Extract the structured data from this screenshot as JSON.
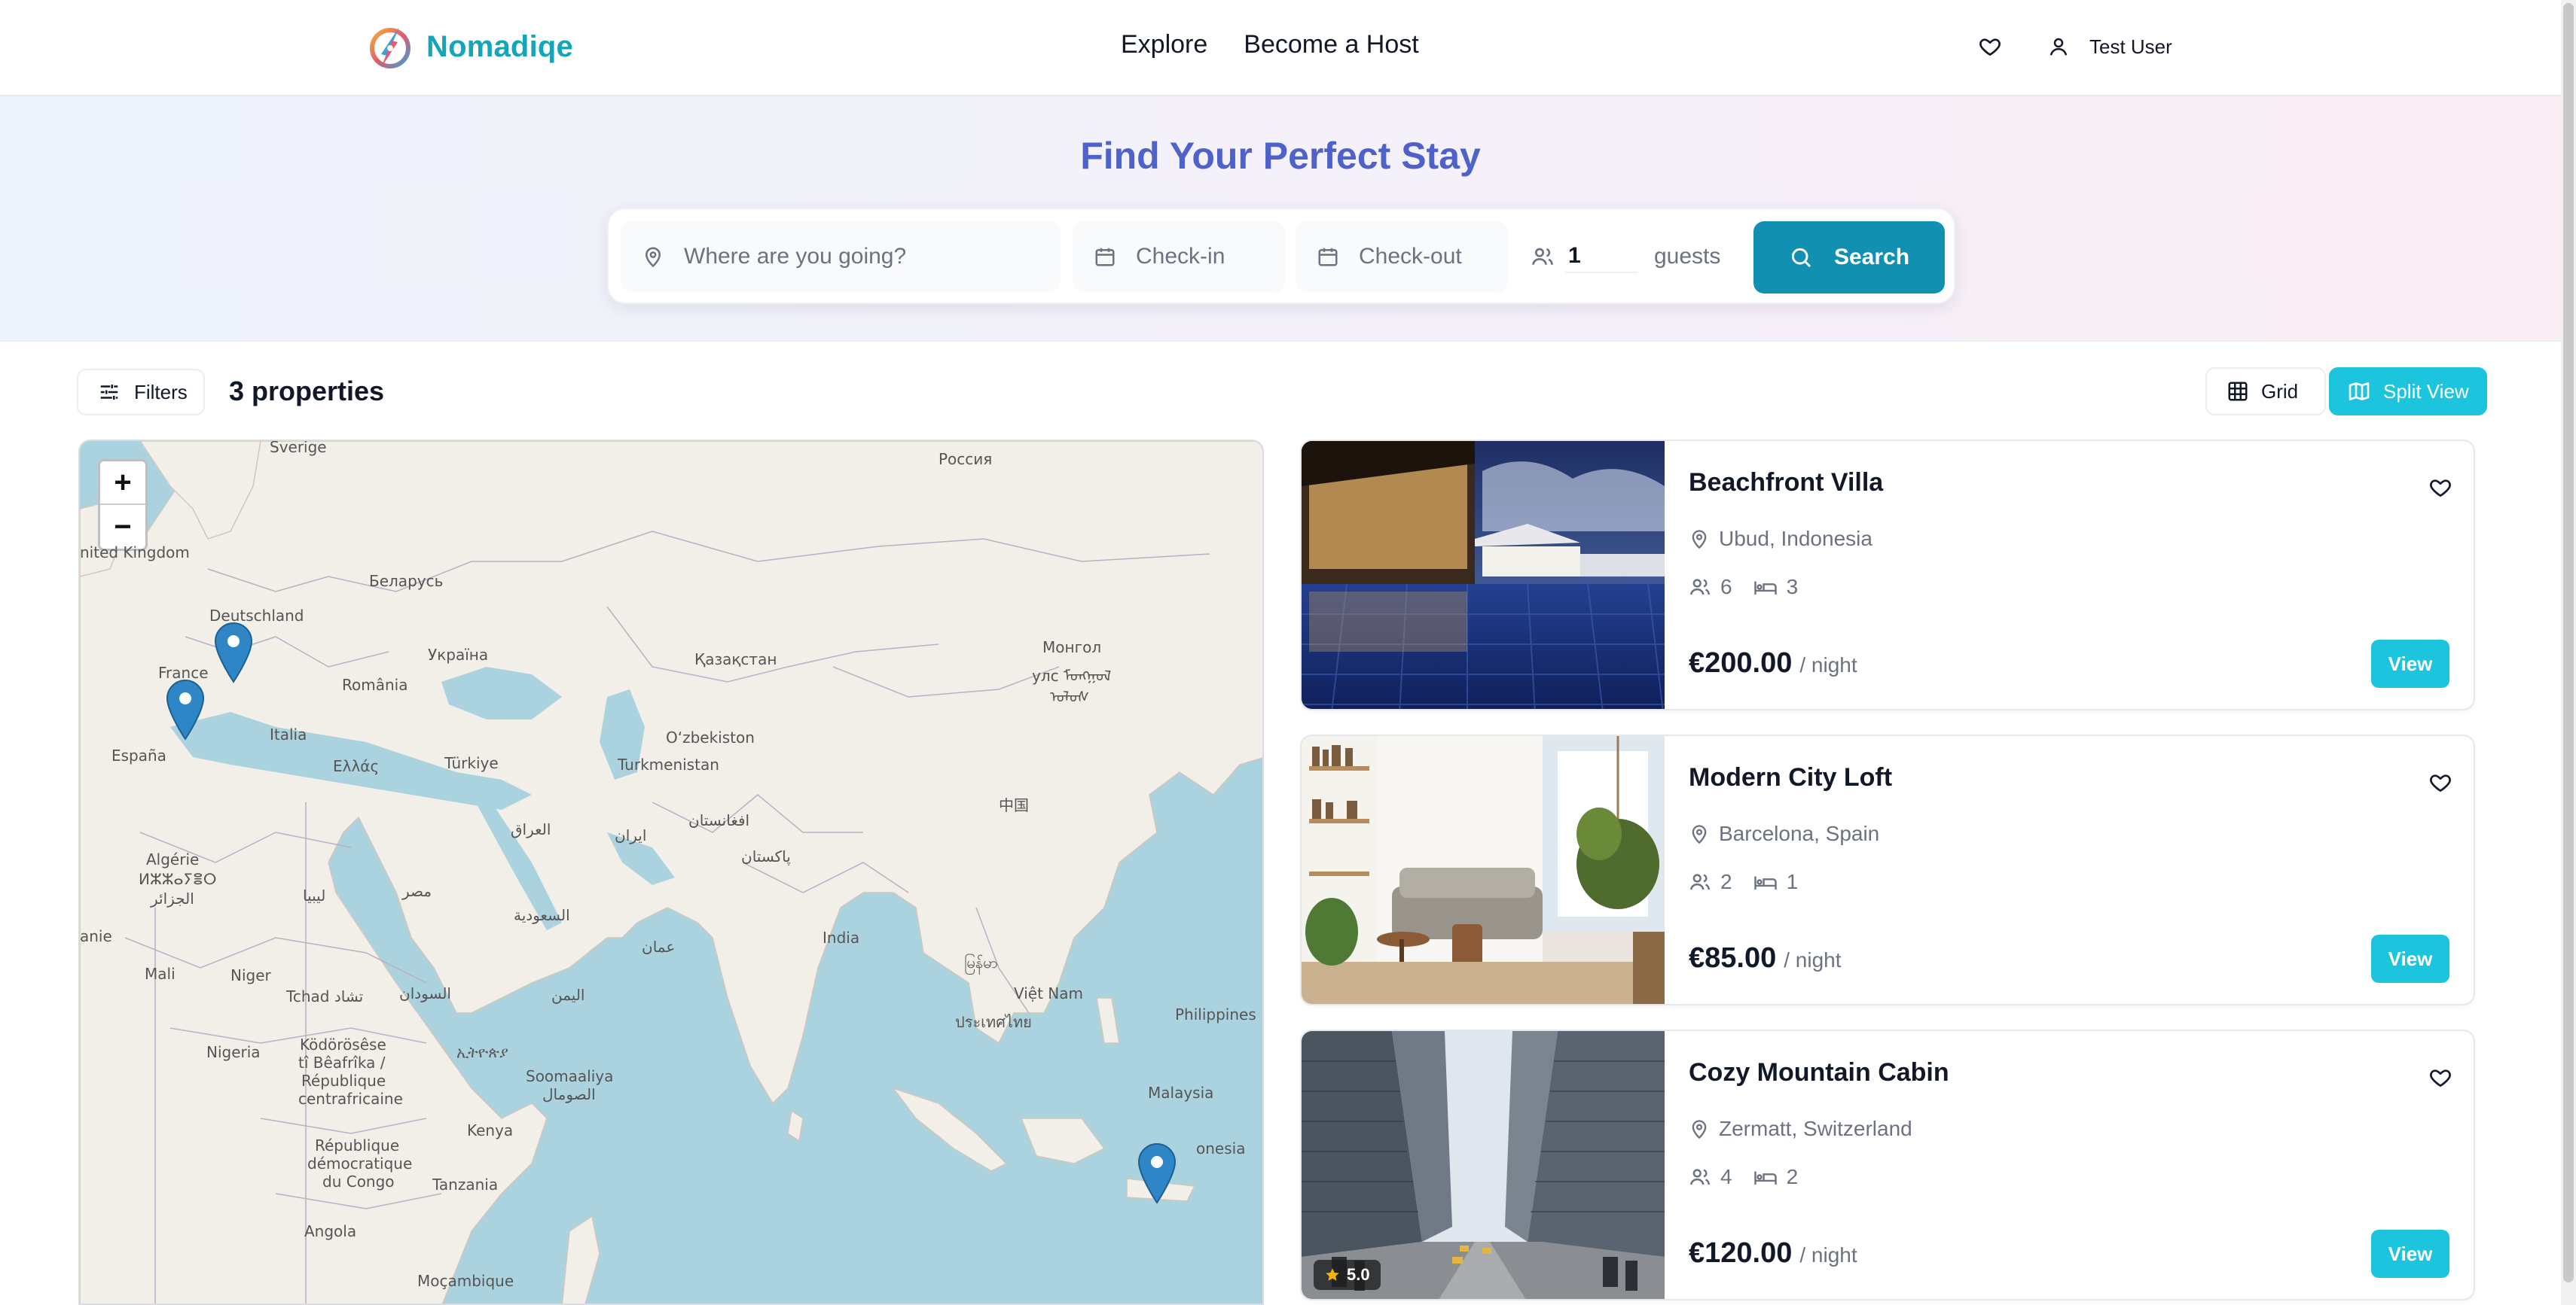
{
  "brand": {
    "name": "Nomadiqe"
  },
  "nav": {
    "explore": "Explore",
    "host": "Become a Host"
  },
  "user": {
    "name": "Test User"
  },
  "hero": {
    "title": "Find Your Perfect Stay"
  },
  "search": {
    "where_placeholder": "Where are you going?",
    "checkin_placeholder": "Check-in",
    "checkout_placeholder": "Check-out",
    "guests_value": "1",
    "guests_label": "guests",
    "button_label": "Search"
  },
  "toolbar": {
    "filters_label": "Filters",
    "count_label": "3 properties",
    "grid_label": "Grid",
    "split_label": "Split View",
    "active_view": "Split View"
  },
  "map": {
    "zoom_in": "+",
    "zoom_out": "−",
    "labels": [
      "Sverige",
      "Россия",
      "nited Kingdom",
      "Беларусь",
      "Deutschland",
      "Україна",
      "Монгол",
      "улс ᠮᠣᠩᠭᠣᠯ",
      "ᠤᠯᠤᠰ",
      "France",
      "România",
      "Қазақстан",
      "España",
      "Italia",
      "Ελλάς",
      "Türkiye",
      "O‘zbekiston",
      "Turkmenistan",
      "中国",
      "افغانستان",
      "العراق",
      "ایران",
      "پاکستان",
      "Algérie",
      "ⵍⵣⵣⴰⵢⴻⵔ",
      "الجزائر",
      "ليبيا",
      "مصر",
      "السعودية",
      "anie",
      "India",
      "မြန်မာ",
      "عمان",
      "Mali",
      "Niger",
      "Tchad تشاد",
      "السودان",
      "اليمن",
      "Việt Nam",
      "ประเทศไทย",
      "Philippines",
      "Nigeria",
      "Ködörösêse",
      "tî Bêafrîka /",
      "République",
      "centrafricaine",
      "ኢትዮጵያ",
      "Soomaaliya",
      "الصومال",
      "Malaysia",
      "Kenya",
      "onesia",
      "République",
      "démocratique",
      "du Congo",
      "Tanzania",
      "Angola",
      "Moçambique"
    ],
    "marker_color": "#2f86c6",
    "water_color": "#abd3df",
    "land_color": "#f2efe9"
  },
  "listings": [
    {
      "title": "Beachfront Villa",
      "location": "Ubud, Indonesia",
      "guests": "6",
      "beds": "3",
      "price": "€200.00",
      "per": "/ night",
      "view_label": "View"
    },
    {
      "title": "Modern City Loft",
      "location": "Barcelona, Spain",
      "guests": "2",
      "beds": "1",
      "price": "€85.00",
      "per": "/ night",
      "view_label": "View"
    },
    {
      "title": "Cozy Mountain Cabin",
      "location": "Zermatt, Switzerland",
      "guests": "4",
      "beds": "2",
      "price": "€120.00",
      "per": "/ night",
      "view_label": "View",
      "rating": "5.0"
    }
  ],
  "icons": [
    "logo-icon",
    "heart-icon",
    "user-icon",
    "map-pin-icon",
    "calendar-icon",
    "users-icon",
    "search-icon",
    "filters-icon",
    "grid-icon",
    "map-icon",
    "bed-icon",
    "star-icon",
    "map-marker-icon"
  ],
  "colors": {
    "brand": "#14a5b8",
    "accent": "#1cc4de",
    "search_button": "#1290b2",
    "hero_title": "#4f62c9"
  }
}
